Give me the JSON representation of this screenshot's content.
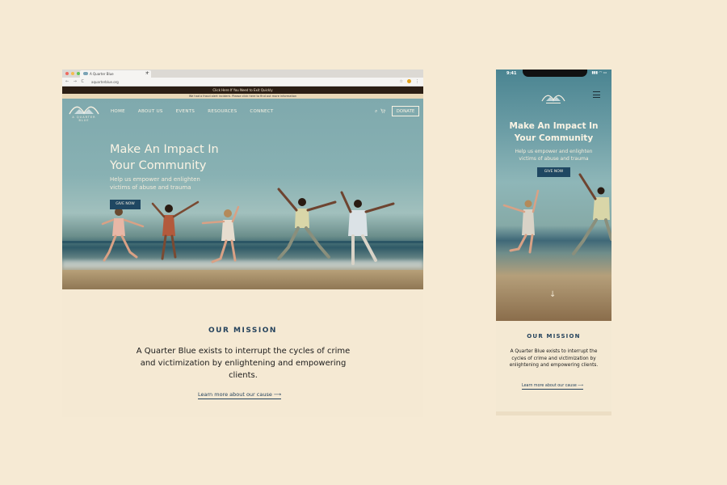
{
  "browser": {
    "tab_title": "A Quarter Blue",
    "tab_close": "×",
    "tab_new": "+",
    "nav_icons": "← → C",
    "url": "aquarterblue.org",
    "addr_icons": "☆",
    "menu_dots": "⋮"
  },
  "site": {
    "exit_bar": "Click Here If You Need to Exit Quickly",
    "alert_bar": "We had a fraud alert incident. Please click here to find out more information",
    "logo_text": "A QUARTER BLUE",
    "nav": [
      "HOME",
      "ABOUT US",
      "EVENTS",
      "RESOURCES",
      "CONNECT"
    ],
    "search_icon": "⌕",
    "cart_icon": "🛒",
    "donate_label": "DONATE",
    "hero_title": "Make An Impact In Your Community",
    "hero_subtitle": "Help us empower and enlighten victims of abuse and trauma",
    "give_label": "GIVE NOW",
    "mission_title": "OUR MISSION",
    "mission_text": "A Quarter Blue exists to interrupt the cycles of crime and victimization by enlightening and empowering clients.",
    "mission_link": "Learn more about our cause  ⟶"
  },
  "phone": {
    "time": "9:41",
    "status_icons": "▮▮▮ ◠ ▭",
    "hero_title": "Make An Impact In Your Community",
    "hero_subtitle": "Help us empower and enlighten victims of abuse and trauma",
    "give_label": "GIVE NOW",
    "scroll_arrow": "↓",
    "mission_title": "OUR MISSION",
    "mission_text": "A Quarter Blue exists to interrupt the cycles of crime and victimization by enlightening and empowering clients.",
    "mission_link": "Learn more about our cause  ⟶"
  },
  "colors": {
    "background": "#f6ead4",
    "brand_navy": "#1f4762",
    "exit_bar": "#2b1e14"
  }
}
